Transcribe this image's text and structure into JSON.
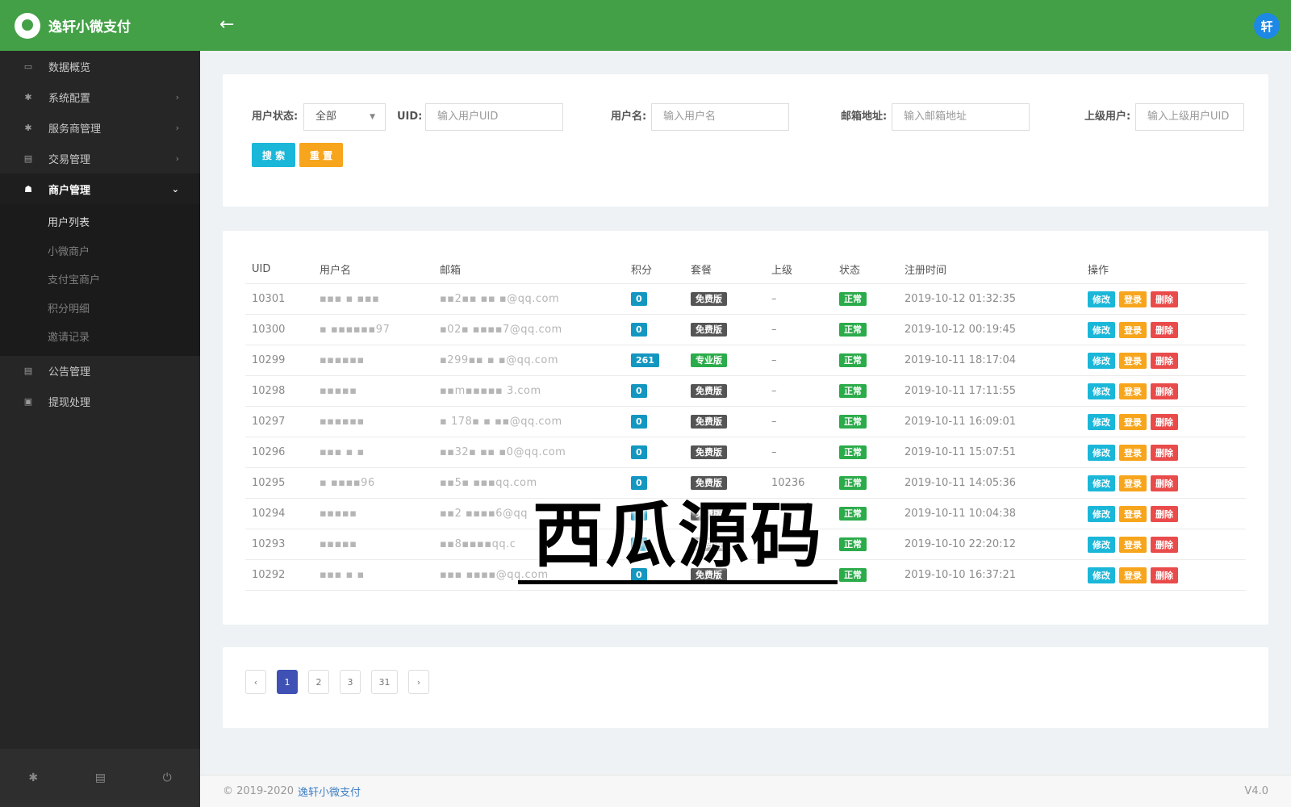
{
  "app": {
    "title": "逸轩小微支付"
  },
  "sidebar": {
    "items": [
      {
        "label": "数据概览",
        "icon": "dashboard-icon",
        "has_arrow": false
      },
      {
        "label": "系统配置",
        "icon": "gear-icon",
        "has_arrow": true
      },
      {
        "label": "服务商管理",
        "icon": "gear-icon",
        "has_arrow": true
      },
      {
        "label": "交易管理",
        "icon": "calendar-icon",
        "has_arrow": true
      }
    ],
    "active_item": {
      "label": "商户管理",
      "icon": "users-icon"
    },
    "submenu": [
      "用户列表",
      "小微商户",
      "支付宝商户",
      "积分明细",
      "邀请记录"
    ],
    "bottom_items": [
      {
        "label": "公告管理",
        "icon": "calendar-icon"
      },
      {
        "label": "提现处理",
        "icon": "card-icon"
      }
    ]
  },
  "header": {
    "avatar_text": "轩"
  },
  "filter": {
    "status_label": "用户状态:",
    "status_value": "全部",
    "uid_label": "UID:",
    "uid_placeholder": "输入用户UID",
    "name_label": "用户名:",
    "name_placeholder": "输入用户名",
    "email_label": "邮箱地址:",
    "email_placeholder": "输入邮箱地址",
    "parent_label": "上级用户:",
    "parent_placeholder": "输入上级用户UID",
    "search_label": "搜 索",
    "reset_label": "重 置"
  },
  "table": {
    "columns": [
      "UID",
      "用户名",
      "邮箱",
      "积分",
      "套餐",
      "上级",
      "状态",
      "注册时间",
      "操作"
    ],
    "actions": {
      "edit": "修改",
      "login": "登录",
      "delete": "删除"
    },
    "rows": [
      {
        "uid": "10301",
        "name": "▪▪▪ ▪ ▪▪▪",
        "email": "▪▪2▪▪ ▪▪ ▪@qq.com",
        "points": "0",
        "package": "免费版",
        "pkg_type": "free",
        "parent": "–",
        "status": "正常",
        "time": "2019-10-12 01:32:35"
      },
      {
        "uid": "10300",
        "name": "▪ ▪▪▪▪▪▪97",
        "email": "▪02▪ ▪▪▪▪7@qq.com",
        "points": "0",
        "package": "免费版",
        "pkg_type": "free",
        "parent": "–",
        "status": "正常",
        "time": "2019-10-12 00:19:45"
      },
      {
        "uid": "10299",
        "name": "▪▪▪▪▪▪",
        "email": "▪299▪▪ ▪ ▪@qq.com",
        "points": "261",
        "package": "专业版",
        "pkg_type": "pro",
        "parent": "–",
        "status": "正常",
        "time": "2019-10-11 18:17:04"
      },
      {
        "uid": "10298",
        "name": "▪▪▪▪▪",
        "email": "▪▪m▪▪▪▪▪ 3.com",
        "points": "0",
        "package": "免费版",
        "pkg_type": "free",
        "parent": "–",
        "status": "正常",
        "time": "2019-10-11 17:11:55"
      },
      {
        "uid": "10297",
        "name": "▪▪▪▪▪▪",
        "email": "▪ 178▪ ▪ ▪▪@qq.com",
        "points": "0",
        "package": "免费版",
        "pkg_type": "free",
        "parent": "–",
        "status": "正常",
        "time": "2019-10-11 16:09:01"
      },
      {
        "uid": "10296",
        "name": "▪▪▪ ▪ ▪",
        "email": "▪▪32▪ ▪▪ ▪0@qq.com",
        "points": "0",
        "package": "免费版",
        "pkg_type": "free",
        "parent": "–",
        "status": "正常",
        "time": "2019-10-11 15:07:51"
      },
      {
        "uid": "10295",
        "name": "▪ ▪▪▪▪96",
        "email": "▪▪5▪ ▪▪▪qq.com",
        "points": "0",
        "package": "免费版",
        "pkg_type": "free",
        "parent": "10236",
        "status": "正常",
        "time": "2019-10-11 14:05:36"
      },
      {
        "uid": "10294",
        "name": "▪▪▪▪▪",
        "email": "▪▪2 ▪▪▪▪6@qq",
        "points": "0",
        "package": "免费版",
        "pkg_type": "free",
        "parent": "",
        "status": "正常",
        "time": "2019-10-11 10:04:38"
      },
      {
        "uid": "10293",
        "name": "▪▪▪▪▪",
        "email": "▪▪8▪▪▪▪qq.c",
        "points": "0",
        "package": "免费版",
        "pkg_type": "free",
        "parent": "",
        "status": "正常",
        "time": "2019-10-10 22:20:12"
      },
      {
        "uid": "10292",
        "name": "▪▪▪ ▪ ▪",
        "email": "▪▪▪ ▪▪▪▪@qq.com",
        "points": "0",
        "package": "免费版",
        "pkg_type": "free",
        "parent": "",
        "status": "正常",
        "time": "2019-10-10 16:37:21"
      }
    ]
  },
  "pagination": {
    "prev": "‹",
    "pages": [
      "1",
      "2",
      "3",
      "31"
    ],
    "current": "1",
    "next": "›"
  },
  "watermark": "西瓜源码",
  "footer": {
    "copyright": "© 2019-2020",
    "link": "逸轩小微支付",
    "version": "V4.0"
  },
  "colors": {
    "header_green": "#43a047",
    "sidebar_dark": "#262626",
    "info": "#1ab7d9",
    "warning": "#f7a51c",
    "danger": "#e94b4b",
    "success": "#2bab4a",
    "page_active": "#3f51b5"
  }
}
